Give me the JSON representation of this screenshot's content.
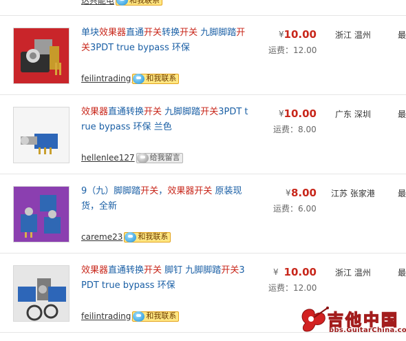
{
  "top_partial": {
    "seller": "达共能电",
    "contact_label": "和我联系"
  },
  "listings": [
    {
      "title_segments": [
        {
          "text": "单块",
          "hl": false
        },
        {
          "text": "效果器",
          "hl": true
        },
        {
          "text": "直通",
          "hl": false
        },
        {
          "text": "开关",
          "hl": true
        },
        {
          "text": "转换",
          "hl": false
        },
        {
          "text": "开关",
          "hl": true
        },
        {
          "text": " 九脚脚踏",
          "hl": false
        },
        {
          "text": "开关",
          "hl": true
        },
        {
          "text": "3PDT true bypass 环保",
          "hl": false
        }
      ],
      "price": "10.00",
      "currency": "¥",
      "shipping": "运费：12.00",
      "location": "浙江 温州",
      "cut_text": "最近",
      "seller": "feilintrading",
      "contact_type": "wang",
      "contact_label": "和我联系",
      "thumb": "red"
    },
    {
      "title_segments": [
        {
          "text": "效果器",
          "hl": true
        },
        {
          "text": "直通转换",
          "hl": false
        },
        {
          "text": "开关",
          "hl": true
        },
        {
          "text": " 九脚脚踏",
          "hl": false
        },
        {
          "text": "开关",
          "hl": true
        },
        {
          "text": "3PDT true bypass 环保 兰色",
          "hl": false
        }
      ],
      "price": "10.00",
      "currency": "¥",
      "shipping": "运费：8.00",
      "location": "广东 深圳",
      "cut_text": "最近",
      "seller": "hellenlee127",
      "contact_type": "msg",
      "contact_label": "给我留言",
      "thumb": "blue"
    },
    {
      "title_segments": [
        {
          "text": "9（九）脚脚踏",
          "hl": false
        },
        {
          "text": "开关",
          "hl": true
        },
        {
          "text": "，",
          "hl": false
        },
        {
          "text": "效果器开关",
          "hl": true
        },
        {
          "text": " 原装现货，全新",
          "hl": false
        }
      ],
      "price": "8.00",
      "currency": "¥",
      "shipping": "运费：6.00",
      "location": "江苏 张家港",
      "cut_text": "最近",
      "seller": "careme23",
      "contact_type": "wang",
      "contact_label": "和我联系",
      "thumb": "purple"
    },
    {
      "title_segments": [
        {
          "text": "效果器",
          "hl": true
        },
        {
          "text": "直通转换",
          "hl": false
        },
        {
          "text": "开关",
          "hl": true
        },
        {
          "text": " 脚钉 九脚脚踏",
          "hl": false
        },
        {
          "text": "开关",
          "hl": true
        },
        {
          "text": "3PDT true bypass 环保",
          "hl": false
        }
      ],
      "price": "10.00",
      "currency": "¥",
      "shipping": "运费：12.00",
      "location": "浙江 温州",
      "cut_text": "最近",
      "seller": "feilintrading",
      "contact_type": "wang",
      "contact_label": "和我联系",
      "thumb": "mixed"
    }
  ],
  "watermark": {
    "title": "吉他中国",
    "url": "bbs.GuitarChina.com"
  },
  "colors": {
    "price": "#c8271b",
    "title": "#1a5fa5",
    "highlight": "#c8271b"
  }
}
